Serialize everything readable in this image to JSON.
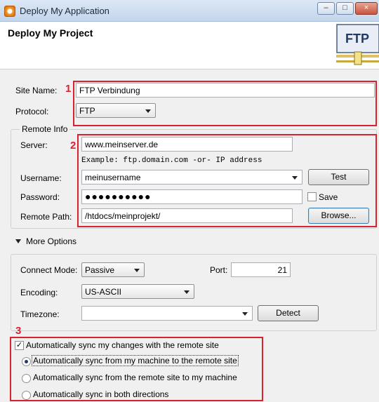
{
  "window": {
    "title": "Deploy My Application",
    "controls": {
      "minimize": "–",
      "maximize": "□",
      "close": "×"
    }
  },
  "banner": {
    "title": "Deploy My Project",
    "logo_text": "FTP"
  },
  "annotations": [
    "1",
    "2",
    "3"
  ],
  "form": {
    "site_name_label": "Site Name:",
    "site_name_value": "FTP Verbindung",
    "protocol_label": "Protocol:",
    "protocol_value": "FTP",
    "remote_info_label": "Remote Info",
    "server_label": "Server:",
    "server_value": "www.meinserver.de",
    "server_hint": "Example: ftp.domain.com -or- IP address",
    "username_label": "Username:",
    "username_value": "meinusername",
    "test_button": "Test",
    "password_label": "Password:",
    "password_value": "●●●●●●●●●●",
    "save_label": "Save",
    "save_checked": false,
    "remote_path_label": "Remote Path:",
    "remote_path_value": "/htdocs/meinprojekt/",
    "browse_button": "Browse..."
  },
  "more_options": {
    "toggle_label": "More Options",
    "connect_mode_label": "Connect Mode:",
    "connect_mode_value": "Passive",
    "port_label": "Port:",
    "port_value": "21",
    "encoding_label": "Encoding:",
    "encoding_value": "US-ASCII",
    "timezone_label": "Timezone:",
    "timezone_value": "",
    "detect_button": "Detect"
  },
  "sync": {
    "auto_sync_label": "Automatically sync my changes with the remote site",
    "auto_sync_checked": true,
    "options": [
      {
        "label": "Automatically sync from my machine to the remote site",
        "selected": true
      },
      {
        "label": "Automatically sync from the remote site to my machine",
        "selected": false
      },
      {
        "label": "Automatically sync in both directions",
        "selected": false
      }
    ]
  },
  "colors": {
    "annotation_red": "#d8222f",
    "titlebar": "#c4d6ec"
  }
}
